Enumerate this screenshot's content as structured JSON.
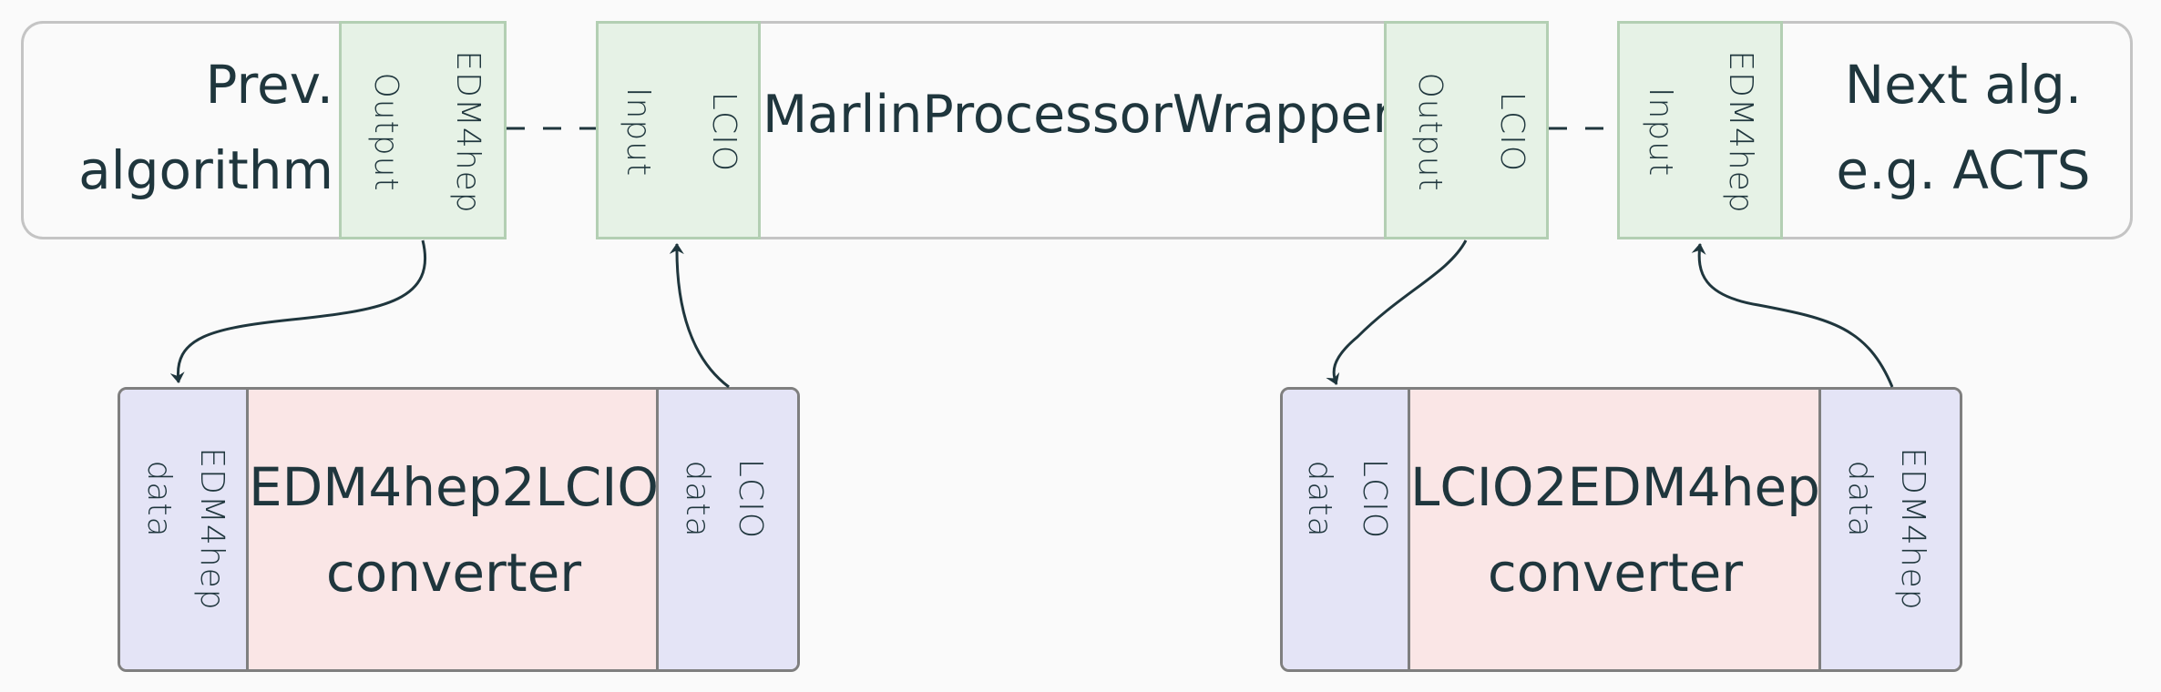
{
  "diagram": {
    "prev_algorithm": {
      "label_line1": "Prev.",
      "label_line2": "algorithm",
      "port": {
        "direction": "Output",
        "type": "EDM4hep"
      }
    },
    "wrapper": {
      "label": "MarlinProcessorWrapper",
      "input_port": {
        "direction": "Input",
        "type": "LCIO"
      },
      "output_port": {
        "direction": "Output",
        "type": "LCIO"
      }
    },
    "next_algorithm": {
      "label_line1": "Next alg.",
      "label_line2": "e.g. ACTS",
      "port": {
        "direction": "Input",
        "type": "EDM4hep"
      }
    },
    "converter_left": {
      "label_line1": "EDM4hep2LCIO",
      "label_line2": "converter",
      "in_port": {
        "line1": "EDM4hep",
        "line2": "data"
      },
      "out_port": {
        "line1": "LCIO",
        "line2": "data"
      }
    },
    "converter_right": {
      "label_line1": "LCIO2EDM4hep",
      "label_line2": "converter",
      "in_port": {
        "line1": "LCIO",
        "line2": "data"
      },
      "out_port": {
        "line1": "EDM4hep",
        "line2": "data"
      }
    },
    "edges": [
      {
        "from": "prev_algorithm.output",
        "to": "converter_left.in",
        "style": "arrow"
      },
      {
        "from": "converter_left.out",
        "to": "wrapper.input",
        "style": "arrow"
      },
      {
        "from": "wrapper.output",
        "to": "converter_right.in",
        "style": "arrow"
      },
      {
        "from": "converter_right.out",
        "to": "next_algorithm.input",
        "style": "arrow"
      },
      {
        "from": "prev_algorithm.output",
        "to": "wrapper.input",
        "style": "dashed"
      },
      {
        "from": "wrapper.output",
        "to": "next_algorithm.input",
        "style": "dashed"
      }
    ],
    "colors": {
      "text": "#1f363d",
      "port_green_fill": "#e6f2e6",
      "port_green_stroke": "#b3cfb3",
      "data_blue_fill": "#e4e4f6",
      "converter_pink_fill": "#fae6e6",
      "algorithm_stroke": "#c4c4c4",
      "converter_stroke": "#7f7f7f"
    }
  }
}
